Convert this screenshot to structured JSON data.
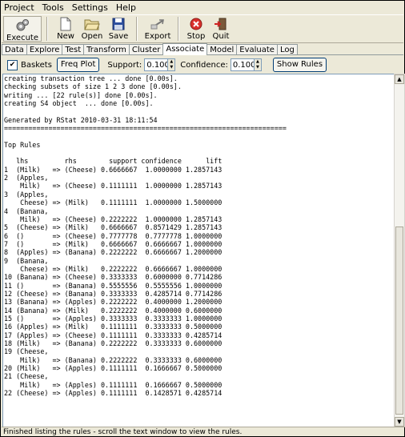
{
  "menu": [
    "Project",
    "Tools",
    "Settings",
    "Help"
  ],
  "toolbar": {
    "execute": "Execute",
    "new": "New",
    "open": "Open",
    "save": "Save",
    "export": "Export",
    "stop": "Stop",
    "quit": "Quit"
  },
  "tabs": [
    "Data",
    "Explore",
    "Test",
    "Transform",
    "Cluster",
    "Associate",
    "Model",
    "Evaluate",
    "Log"
  ],
  "active_tab": "Associate",
  "options": {
    "baskets_label": "Baskets",
    "freq_plot": "Freq Plot",
    "support_label": "Support:",
    "support_value": "0.1000",
    "confidence_label": "Confidence:",
    "confidence_value": "0.1000",
    "show_rules": "Show Rules"
  },
  "output_text": "creating transaction tree ... done [0.00s].\nchecking subsets of size 1 2 3 done [0.00s].\nwriting ... [22 rule(s)] done [0.00s].\ncreating S4 object  ... done [0.00s].\n\nGenerated by RStat 2010-03-31 18:11:54\n======================================================================\n\nTop Rules\n\n   lhs         rhs        support confidence      lift\n1  (Milk)   => (Cheese) 0.6666667  1.0000000 1.2857143\n2  (Apples,\n    Milk)   => (Cheese) 0.1111111  1.0000000 1.2857143\n3  (Apples,\n    Cheese) => (Milk)   0.1111111  1.0000000 1.5000000\n4  (Banana,\n    Milk)   => (Cheese) 0.2222222  1.0000000 1.2857143\n5  (Cheese) => (Milk)   0.6666667  0.8571429 1.2857143\n6  ()       => (Cheese) 0.7777778  0.7777778 1.0000000\n7  ()       => (Milk)   0.6666667  0.6666667 1.0000000\n8  (Apples) => (Banana) 0.2222222  0.6666667 1.2000000\n9  (Banana,\n    Cheese) => (Milk)   0.2222222  0.6666667 1.0000000\n10 (Banana) => (Cheese) 0.3333333  0.6000000 0.7714286\n11 ()       => (Banana) 0.5555556  0.5555556 1.0000000\n12 (Cheese) => (Banana) 0.3333333  0.4285714 0.7714286\n13 (Banana) => (Apples) 0.2222222  0.4000000 1.2000000\n14 (Banana) => (Milk)   0.2222222  0.4000000 0.6000000\n15 ()       => (Apples) 0.3333333  0.3333333 1.0000000\n16 (Apples) => (Milk)   0.1111111  0.3333333 0.5000000\n17 (Apples) => (Cheese) 0.1111111  0.3333333 0.4285714\n18 (Milk)   => (Banana) 0.2222222  0.3333333 0.6000000\n19 (Cheese,\n    Milk)   => (Banana) 0.2222222  0.3333333 0.6000000\n20 (Milk)   => (Apples) 0.1111111  0.1666667 0.5000000\n21 (Cheese,\n    Milk)   => (Apples) 0.1111111  0.1666667 0.5000000\n22 (Cheese) => (Apples) 0.1111111  0.1428571 0.4285714",
  "status": "Finished listing the rules - scroll the text window to view the rules."
}
